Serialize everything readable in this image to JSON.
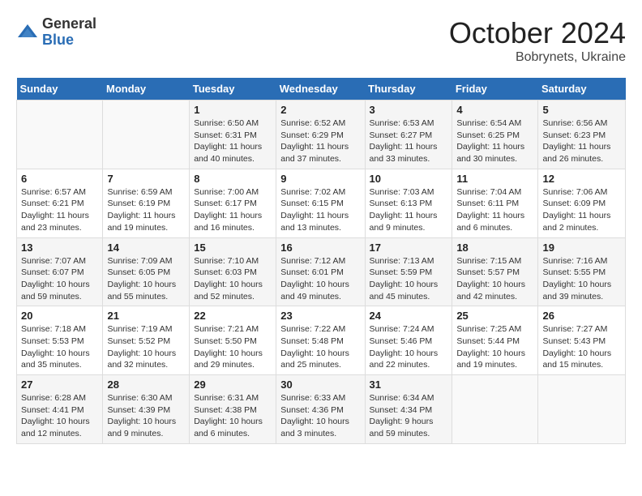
{
  "header": {
    "logo_general": "General",
    "logo_blue": "Blue",
    "month_title": "October 2024",
    "location": "Bobrynets, Ukraine"
  },
  "days_of_week": [
    "Sunday",
    "Monday",
    "Tuesday",
    "Wednesday",
    "Thursday",
    "Friday",
    "Saturday"
  ],
  "weeks": [
    [
      {
        "day": "",
        "sunrise": "",
        "sunset": "",
        "daylight": ""
      },
      {
        "day": "",
        "sunrise": "",
        "sunset": "",
        "daylight": ""
      },
      {
        "day": "1",
        "sunrise": "Sunrise: 6:50 AM",
        "sunset": "Sunset: 6:31 PM",
        "daylight": "Daylight: 11 hours and 40 minutes."
      },
      {
        "day": "2",
        "sunrise": "Sunrise: 6:52 AM",
        "sunset": "Sunset: 6:29 PM",
        "daylight": "Daylight: 11 hours and 37 minutes."
      },
      {
        "day": "3",
        "sunrise": "Sunrise: 6:53 AM",
        "sunset": "Sunset: 6:27 PM",
        "daylight": "Daylight: 11 hours and 33 minutes."
      },
      {
        "day": "4",
        "sunrise": "Sunrise: 6:54 AM",
        "sunset": "Sunset: 6:25 PM",
        "daylight": "Daylight: 11 hours and 30 minutes."
      },
      {
        "day": "5",
        "sunrise": "Sunrise: 6:56 AM",
        "sunset": "Sunset: 6:23 PM",
        "daylight": "Daylight: 11 hours and 26 minutes."
      }
    ],
    [
      {
        "day": "6",
        "sunrise": "Sunrise: 6:57 AM",
        "sunset": "Sunset: 6:21 PM",
        "daylight": "Daylight: 11 hours and 23 minutes."
      },
      {
        "day": "7",
        "sunrise": "Sunrise: 6:59 AM",
        "sunset": "Sunset: 6:19 PM",
        "daylight": "Daylight: 11 hours and 19 minutes."
      },
      {
        "day": "8",
        "sunrise": "Sunrise: 7:00 AM",
        "sunset": "Sunset: 6:17 PM",
        "daylight": "Daylight: 11 hours and 16 minutes."
      },
      {
        "day": "9",
        "sunrise": "Sunrise: 7:02 AM",
        "sunset": "Sunset: 6:15 PM",
        "daylight": "Daylight: 11 hours and 13 minutes."
      },
      {
        "day": "10",
        "sunrise": "Sunrise: 7:03 AM",
        "sunset": "Sunset: 6:13 PM",
        "daylight": "Daylight: 11 hours and 9 minutes."
      },
      {
        "day": "11",
        "sunrise": "Sunrise: 7:04 AM",
        "sunset": "Sunset: 6:11 PM",
        "daylight": "Daylight: 11 hours and 6 minutes."
      },
      {
        "day": "12",
        "sunrise": "Sunrise: 7:06 AM",
        "sunset": "Sunset: 6:09 PM",
        "daylight": "Daylight: 11 hours and 2 minutes."
      }
    ],
    [
      {
        "day": "13",
        "sunrise": "Sunrise: 7:07 AM",
        "sunset": "Sunset: 6:07 PM",
        "daylight": "Daylight: 10 hours and 59 minutes."
      },
      {
        "day": "14",
        "sunrise": "Sunrise: 7:09 AM",
        "sunset": "Sunset: 6:05 PM",
        "daylight": "Daylight: 10 hours and 55 minutes."
      },
      {
        "day": "15",
        "sunrise": "Sunrise: 7:10 AM",
        "sunset": "Sunset: 6:03 PM",
        "daylight": "Daylight: 10 hours and 52 minutes."
      },
      {
        "day": "16",
        "sunrise": "Sunrise: 7:12 AM",
        "sunset": "Sunset: 6:01 PM",
        "daylight": "Daylight: 10 hours and 49 minutes."
      },
      {
        "day": "17",
        "sunrise": "Sunrise: 7:13 AM",
        "sunset": "Sunset: 5:59 PM",
        "daylight": "Daylight: 10 hours and 45 minutes."
      },
      {
        "day": "18",
        "sunrise": "Sunrise: 7:15 AM",
        "sunset": "Sunset: 5:57 PM",
        "daylight": "Daylight: 10 hours and 42 minutes."
      },
      {
        "day": "19",
        "sunrise": "Sunrise: 7:16 AM",
        "sunset": "Sunset: 5:55 PM",
        "daylight": "Daylight: 10 hours and 39 minutes."
      }
    ],
    [
      {
        "day": "20",
        "sunrise": "Sunrise: 7:18 AM",
        "sunset": "Sunset: 5:53 PM",
        "daylight": "Daylight: 10 hours and 35 minutes."
      },
      {
        "day": "21",
        "sunrise": "Sunrise: 7:19 AM",
        "sunset": "Sunset: 5:52 PM",
        "daylight": "Daylight: 10 hours and 32 minutes."
      },
      {
        "day": "22",
        "sunrise": "Sunrise: 7:21 AM",
        "sunset": "Sunset: 5:50 PM",
        "daylight": "Daylight: 10 hours and 29 minutes."
      },
      {
        "day": "23",
        "sunrise": "Sunrise: 7:22 AM",
        "sunset": "Sunset: 5:48 PM",
        "daylight": "Daylight: 10 hours and 25 minutes."
      },
      {
        "day": "24",
        "sunrise": "Sunrise: 7:24 AM",
        "sunset": "Sunset: 5:46 PM",
        "daylight": "Daylight: 10 hours and 22 minutes."
      },
      {
        "day": "25",
        "sunrise": "Sunrise: 7:25 AM",
        "sunset": "Sunset: 5:44 PM",
        "daylight": "Daylight: 10 hours and 19 minutes."
      },
      {
        "day": "26",
        "sunrise": "Sunrise: 7:27 AM",
        "sunset": "Sunset: 5:43 PM",
        "daylight": "Daylight: 10 hours and 15 minutes."
      }
    ],
    [
      {
        "day": "27",
        "sunrise": "Sunrise: 6:28 AM",
        "sunset": "Sunset: 4:41 PM",
        "daylight": "Daylight: 10 hours and 12 minutes."
      },
      {
        "day": "28",
        "sunrise": "Sunrise: 6:30 AM",
        "sunset": "Sunset: 4:39 PM",
        "daylight": "Daylight: 10 hours and 9 minutes."
      },
      {
        "day": "29",
        "sunrise": "Sunrise: 6:31 AM",
        "sunset": "Sunset: 4:38 PM",
        "daylight": "Daylight: 10 hours and 6 minutes."
      },
      {
        "day": "30",
        "sunrise": "Sunrise: 6:33 AM",
        "sunset": "Sunset: 4:36 PM",
        "daylight": "Daylight: 10 hours and 3 minutes."
      },
      {
        "day": "31",
        "sunrise": "Sunrise: 6:34 AM",
        "sunset": "Sunset: 4:34 PM",
        "daylight": "Daylight: 9 hours and 59 minutes."
      },
      {
        "day": "",
        "sunrise": "",
        "sunset": "",
        "daylight": ""
      },
      {
        "day": "",
        "sunrise": "",
        "sunset": "",
        "daylight": ""
      }
    ]
  ]
}
